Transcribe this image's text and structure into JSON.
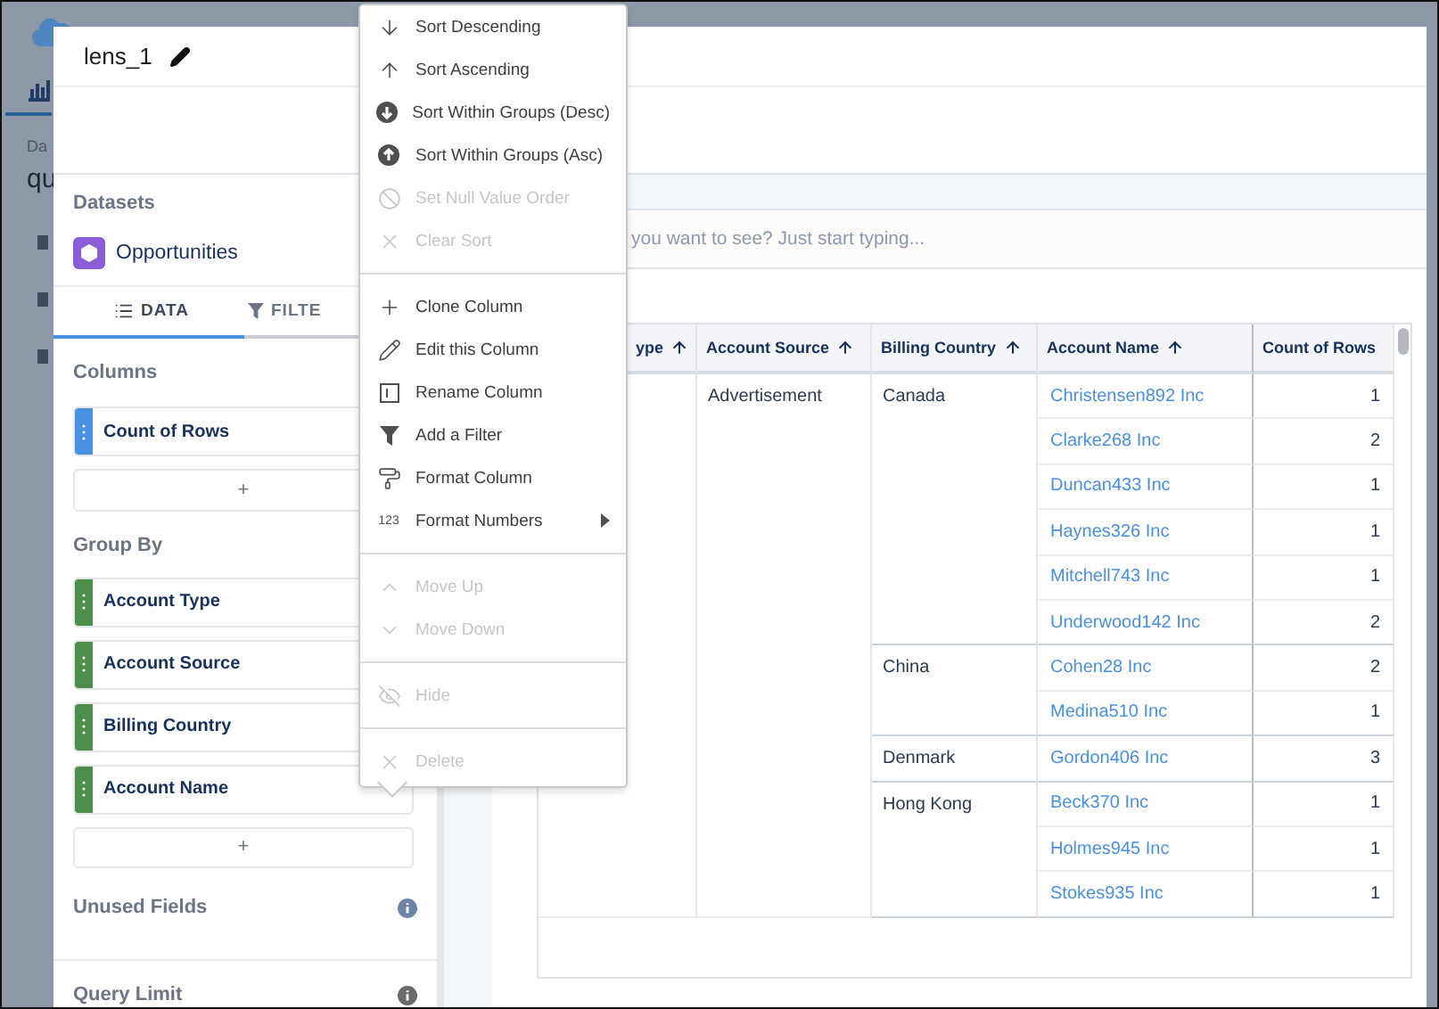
{
  "backdrop": {
    "caption": "Da",
    "title": "qu"
  },
  "lens": {
    "title": "lens_1"
  },
  "datasets": {
    "heading": "Datasets",
    "items": [
      {
        "name": "Opportunities"
      }
    ]
  },
  "tabs": [
    {
      "label": "DATA",
      "selected": true
    },
    {
      "label": "FILTE",
      "selected": false
    }
  ],
  "sections": [
    {
      "heading": "Columns",
      "add_label": "+",
      "pills": [
        {
          "label": "Count of Rows",
          "kind": "measure"
        }
      ]
    },
    {
      "heading": "Group By",
      "add_label": "+",
      "pills": [
        {
          "label": "Account Type",
          "kind": "dimension"
        },
        {
          "label": "Account Source",
          "kind": "dimension"
        },
        {
          "label": "Billing Country",
          "kind": "dimension"
        },
        {
          "label": "Account Name",
          "kind": "dimension"
        }
      ]
    }
  ],
  "info_sections": [
    {
      "heading": "Unused Fields"
    },
    {
      "heading": "Query Limit"
    }
  ],
  "query": {
    "placeholder": "you want to see? Just start typing..."
  },
  "table": {
    "columns": [
      {
        "label": "ype",
        "sorted": true
      },
      {
        "label": "Account Source",
        "sorted": true
      },
      {
        "label": "Billing Country",
        "sorted": true
      },
      {
        "label": "Account Name",
        "sorted": true
      },
      {
        "label": "Count of Rows",
        "sorted": false
      }
    ],
    "sources": [
      {
        "source": "Advertisement",
        "countries": [
          {
            "country": "Canada",
            "accounts": [
              {
                "name": "Christensen892 Inc",
                "count": "1"
              },
              {
                "name": "Clarke268 Inc",
                "count": "2"
              },
              {
                "name": "Duncan433 Inc",
                "count": "1"
              },
              {
                "name": "Haynes326 Inc",
                "count": "1"
              },
              {
                "name": "Mitchell743 Inc",
                "count": "1"
              },
              {
                "name": "Underwood142 Inc",
                "count": "2"
              }
            ]
          },
          {
            "country": "China",
            "accounts": [
              {
                "name": "Cohen28 Inc",
                "count": "2"
              },
              {
                "name": "Medina510 Inc",
                "count": "1"
              }
            ]
          },
          {
            "country": "Denmark",
            "accounts": [
              {
                "name": "Gordon406 Inc",
                "count": "3"
              }
            ]
          },
          {
            "country": "Hong Kong",
            "accounts": [
              {
                "name": "Beck370 Inc",
                "count": "1"
              },
              {
                "name": "Holmes945 Inc",
                "count": "1"
              },
              {
                "name": "Stokes935 Inc",
                "count": "1"
              }
            ]
          }
        ]
      }
    ]
  },
  "menu": {
    "groups": [
      {
        "items": [
          {
            "label": "Sort Descending",
            "disabled": false
          },
          {
            "label": "Sort Ascending",
            "disabled": false
          },
          {
            "label": "Sort Within Groups (Desc)",
            "disabled": false
          },
          {
            "label": "Sort Within Groups (Asc)",
            "disabled": false
          },
          {
            "label": "Set Null Value Order",
            "disabled": true
          },
          {
            "label": "Clear Sort",
            "disabled": true
          }
        ]
      },
      {
        "items": [
          {
            "label": "Clone Column",
            "disabled": false
          },
          {
            "label": "Edit this Column",
            "disabled": false
          },
          {
            "label": "Rename Column",
            "disabled": false
          },
          {
            "label": "Add a Filter",
            "disabled": false
          },
          {
            "label": "Format Column",
            "disabled": false
          },
          {
            "label": "Format Numbers",
            "disabled": false,
            "badge": "123",
            "submenu": true
          }
        ]
      },
      {
        "items": [
          {
            "label": "Move Up",
            "disabled": true
          },
          {
            "label": "Move Down",
            "disabled": true
          }
        ]
      },
      {
        "items": [
          {
            "label": "Hide",
            "disabled": true
          }
        ]
      },
      {
        "items": [
          {
            "label": "Delete",
            "disabled": true
          }
        ]
      }
    ]
  }
}
